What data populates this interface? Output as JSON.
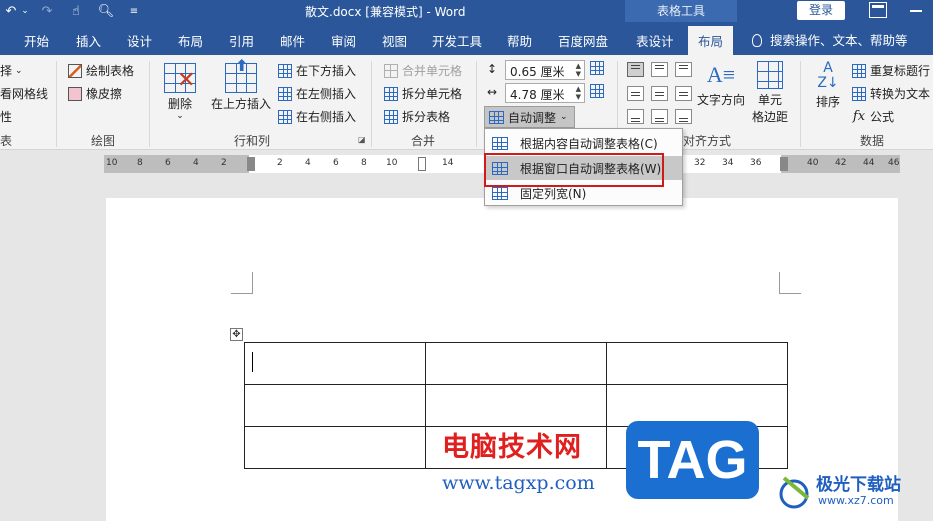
{
  "titlebar": {
    "doc_title": "散文.docx [兼容模式]  -  Word",
    "context_title": "表格工具",
    "login": "登录"
  },
  "tabs": [
    "开始",
    "插入",
    "设计",
    "布局",
    "引用",
    "邮件",
    "审阅",
    "视图",
    "开发工具",
    "帮助",
    "百度网盘",
    "表设计",
    "布局"
  ],
  "active_tab": "布局",
  "tell_me": "搜索操作、文本、帮助等",
  "ribbon": {
    "select_group": {
      "select": "择",
      "gridlines": "看网格线",
      "properties": "性",
      "label": "表"
    },
    "draw_group": {
      "draw_table": "绘制表格",
      "eraser": "橡皮擦",
      "label": "绘图"
    },
    "rows_cols": {
      "delete": "删除",
      "insert_above": "在上方插入",
      "insert_below": "在下方插入",
      "insert_left": "在左侧插入",
      "insert_right": "在右侧插入",
      "label": "行和列"
    },
    "merge": {
      "merge_cells": "合并单元格",
      "split_cells": "拆分单元格",
      "split_table": "拆分表格",
      "label": "合并"
    },
    "cell_size": {
      "height": "0.65 厘米",
      "width": "4.78 厘米",
      "autofit": "自动调整"
    },
    "alignment": {
      "text_direction": "文字方向",
      "cell_margins_1": "单元",
      "cell_margins_2": "格边距",
      "label": "对齐方式"
    },
    "data": {
      "sort": "排序",
      "repeat_header": "重复标题行",
      "convert": "转换为文本",
      "formula": "公式",
      "label": "数据"
    }
  },
  "autofit_menu": [
    {
      "label": "根据内容自动调整表格(C)"
    },
    {
      "label": "根据窗口自动调整表格(W)"
    },
    {
      "label": "固定列宽(N)"
    }
  ],
  "ruler_ticks": [
    "10",
    "8",
    "6",
    "4",
    "2",
    "2",
    "4",
    "6",
    "8",
    "10",
    "14",
    "32",
    "34",
    "36",
    "40",
    "42",
    "44",
    "46"
  ],
  "watermark": {
    "cn": "电脑技术网",
    "url": "www.tagxp.com",
    "tag": "TAG",
    "site": "极光下载站",
    "site_url": "www.xz7.com"
  },
  "colors": {
    "accent": "#2b579a",
    "highlight": "#d31a1a"
  }
}
